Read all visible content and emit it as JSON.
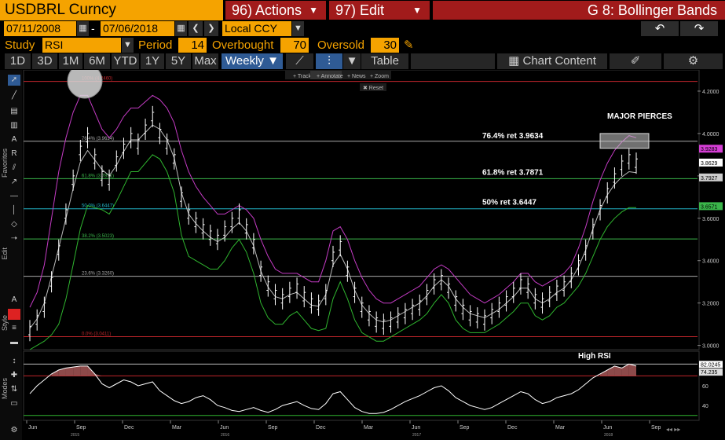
{
  "header": {
    "security": "USDBRL Curncy",
    "actions": "96) Actions",
    "edit": "97) Edit",
    "function": "G 8: Bollinger Bands"
  },
  "dates": {
    "start": "07/11/2008",
    "end": "07/06/2018",
    "currency": "Local CCY"
  },
  "study": {
    "label": "Study",
    "value": "RSI",
    "period_label": "Period",
    "period": "14",
    "overbought_label": "Overbought",
    "overbought": "70",
    "oversold_label": "Oversold",
    "oversold": "30"
  },
  "toolbar": {
    "ranges": [
      "1D",
      "3D",
      "1M",
      "6M",
      "YTD",
      "1Y",
      "5Y",
      "Max"
    ],
    "frequency": "Weekly",
    "table": "Table",
    "chart_content": "Chart Content"
  },
  "mini_toolbar": [
    "Track",
    "Annotate",
    "News",
    "Zoom",
    "Reset"
  ],
  "side_labels": {
    "favorites": "Favorites",
    "edit": "Edit",
    "style": "Style",
    "modes": "Modes"
  },
  "chart_data": {
    "type": "line",
    "annotations": {
      "title_major": "MAJOR PIERCES",
      "fib_764": "76.4% ret 3.9634",
      "fib_618": "61.8% ret 3.7871",
      "fib_50": "50% ret 3.6447",
      "high_rsi": "High RSI"
    },
    "fib_levels": [
      {
        "label": "100% (4.2460)",
        "value": 4.246,
        "color": "#c0262b"
      },
      {
        "label": "76.4% (3.9634)",
        "value": 3.9634,
        "color": "#aaaaaa"
      },
      {
        "label": "61.8% (3.7871)",
        "value": 3.7871,
        "color": "#3ab54a"
      },
      {
        "label": "50.0% (3.6447)",
        "value": 3.6447,
        "color": "#23b6c8"
      },
      {
        "label": "38.2% (3.5023)",
        "value": 3.5023,
        "color": "#3ab54a"
      },
      {
        "label": "23.6% (3.3260)",
        "value": 3.326,
        "color": "#aaaaaa"
      },
      {
        "label": "0.0% (3.0411)",
        "value": 3.0411,
        "color": "#c0262b"
      }
    ],
    "y_ticks": [
      "4.2000",
      "4.0000",
      "3.8000",
      "3.6000",
      "3.4000",
      "3.2000",
      "3.0000"
    ],
    "y_tick_values": [
      4.2,
      4.0,
      3.8,
      3.6,
      3.4,
      3.2,
      3.0
    ],
    "ylim": [
      2.98,
      4.3
    ],
    "price_tags": [
      {
        "text": "3.9283",
        "value": 3.9283,
        "bg": "#d43dd4",
        "fg": "#000000"
      },
      {
        "text": "3.8629",
        "value": 3.8629,
        "bg": "#ffffff",
        "fg": "#000000"
      },
      {
        "text": "3.7927",
        "value": 3.7927,
        "bg": "#cccccc",
        "fg": "#000000"
      },
      {
        "text": "3.6571",
        "value": 3.6571,
        "bg": "#3ab54a",
        "fg": "#000000"
      }
    ],
    "x_ticks": [
      "Jun",
      "Sep",
      "Dec",
      "Mar",
      "Jun",
      "Sep",
      "Dec",
      "Mar",
      "Jun",
      "Sep",
      "Dec",
      "Mar",
      "Jun",
      "Sep"
    ],
    "x_year_labels": [
      "2015",
      "2016",
      "2017",
      "2018"
    ],
    "rsi_ticks": [
      "60",
      "40"
    ],
    "rsi_tick_values": [
      60,
      40
    ],
    "rsi_tags": [
      {
        "text": "82.0245",
        "value": 82.0245,
        "bg": "#ffffff"
      },
      {
        "text": "74.235",
        "value": 74.235,
        "bg": "#dddddd"
      }
    ],
    "rsi_ylim": [
      25,
      95
    ],
    "rsi_overbought": 70,
    "rsi_oversold": 30,
    "series": {
      "price": [
        3.07,
        3.12,
        3.18,
        3.3,
        3.45,
        3.62,
        3.78,
        3.92,
        3.98,
        3.88,
        3.8,
        3.78,
        3.87,
        3.93,
        3.98,
        3.95,
        4.02,
        4.08,
        4.0,
        3.95,
        3.88,
        3.7,
        3.62,
        3.58,
        3.55,
        3.52,
        3.5,
        3.54,
        3.58,
        3.62,
        3.55,
        3.48,
        3.35,
        3.28,
        3.24,
        3.22,
        3.25,
        3.27,
        3.23,
        3.2,
        3.19,
        3.24,
        3.42,
        3.47,
        3.35,
        3.25,
        3.18,
        3.14,
        3.11,
        3.1,
        3.11,
        3.13,
        3.15,
        3.17,
        3.19,
        3.24,
        3.29,
        3.31,
        3.27,
        3.21,
        3.17,
        3.14,
        3.13,
        3.12,
        3.15,
        3.18,
        3.21,
        3.25,
        3.29,
        3.27,
        3.22,
        3.2,
        3.23,
        3.26,
        3.28,
        3.32,
        3.38,
        3.45,
        3.55,
        3.64,
        3.72,
        3.79,
        3.85,
        3.88,
        3.86
      ],
      "upper": [
        3.18,
        3.25,
        3.38,
        3.6,
        3.82,
        3.98,
        4.1,
        4.18,
        4.18,
        4.1,
        4.02,
        3.98,
        4.02,
        4.08,
        4.12,
        4.12,
        4.15,
        4.18,
        4.16,
        4.12,
        4.05,
        3.92,
        3.82,
        3.75,
        3.7,
        3.66,
        3.62,
        3.62,
        3.64,
        3.66,
        3.64,
        3.6,
        3.5,
        3.42,
        3.36,
        3.34,
        3.34,
        3.34,
        3.32,
        3.3,
        3.3,
        3.4,
        3.54,
        3.56,
        3.5,
        3.4,
        3.32,
        3.26,
        3.22,
        3.2,
        3.2,
        3.22,
        3.24,
        3.26,
        3.28,
        3.32,
        3.36,
        3.38,
        3.36,
        3.32,
        3.28,
        3.24,
        3.22,
        3.2,
        3.22,
        3.24,
        3.27,
        3.3,
        3.34,
        3.34,
        3.3,
        3.28,
        3.3,
        3.32,
        3.34,
        3.38,
        3.46,
        3.56,
        3.68,
        3.78,
        3.86,
        3.92,
        3.96,
        3.99,
        3.98
      ],
      "lower": [
        2.98,
        3.0,
        3.02,
        3.05,
        3.1,
        3.22,
        3.38,
        3.55,
        3.66,
        3.65,
        3.64,
        3.62,
        3.68,
        3.75,
        3.82,
        3.82,
        3.86,
        3.9,
        3.88,
        3.82,
        3.72,
        3.52,
        3.42,
        3.4,
        3.38,
        3.36,
        3.36,
        3.4,
        3.46,
        3.5,
        3.44,
        3.34,
        3.2,
        3.13,
        3.1,
        3.1,
        3.14,
        3.16,
        3.12,
        3.08,
        3.07,
        3.08,
        3.22,
        3.3,
        3.22,
        3.12,
        3.06,
        3.04,
        3.02,
        3.02,
        3.04,
        3.06,
        3.08,
        3.1,
        3.12,
        3.15,
        3.2,
        3.24,
        3.2,
        3.12,
        3.08,
        3.06,
        3.06,
        3.06,
        3.08,
        3.1,
        3.13,
        3.16,
        3.2,
        3.2,
        3.14,
        3.12,
        3.14,
        3.18,
        3.2,
        3.24,
        3.28,
        3.34,
        3.42,
        3.5,
        3.56,
        3.6,
        3.63,
        3.65,
        3.65
      ],
      "rsi": [
        52,
        60,
        66,
        72,
        76,
        78,
        79,
        80,
        80,
        72,
        62,
        58,
        62,
        66,
        64,
        60,
        62,
        64,
        55,
        50,
        45,
        42,
        44,
        48,
        50,
        46,
        40,
        38,
        35,
        34,
        36,
        38,
        35,
        33,
        36,
        40,
        42,
        44,
        40,
        37,
        36,
        42,
        52,
        54,
        46,
        38,
        34,
        32,
        32,
        33,
        36,
        40,
        44,
        47,
        50,
        54,
        58,
        60,
        55,
        48,
        44,
        40,
        38,
        36,
        38,
        42,
        46,
        50,
        54,
        52,
        46,
        42,
        44,
        48,
        50,
        52,
        56,
        62,
        68,
        72,
        76,
        80,
        78,
        82,
        80
      ]
    }
  }
}
